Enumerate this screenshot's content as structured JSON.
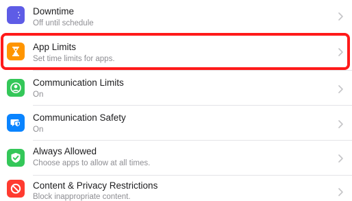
{
  "settings": {
    "items": [
      {
        "title": "Downtime",
        "subtitle": "Off until schedule",
        "icon": "downtime-icon",
        "color": "#5e5ce6"
      },
      {
        "title": "App Limits",
        "subtitle": "Set time limits for apps.",
        "icon": "hourglass-icon",
        "color": "#ff9500"
      },
      {
        "title": "Communication Limits",
        "subtitle": "On",
        "icon": "person-circle-icon",
        "color": "#34c759"
      },
      {
        "title": "Communication Safety",
        "subtitle": "On",
        "icon": "chat-bubble-icon",
        "color": "#0a84ff"
      },
      {
        "title": "Always Allowed",
        "subtitle": "Choose apps to allow at all times.",
        "icon": "checkmark-shield-icon",
        "color": "#34c759"
      },
      {
        "title": "Content & Privacy Restrictions",
        "subtitle": "Block inappropriate content.",
        "icon": "no-entry-icon",
        "color": "#ff3b30"
      }
    ]
  },
  "highlight_color": "#ff1a1a"
}
